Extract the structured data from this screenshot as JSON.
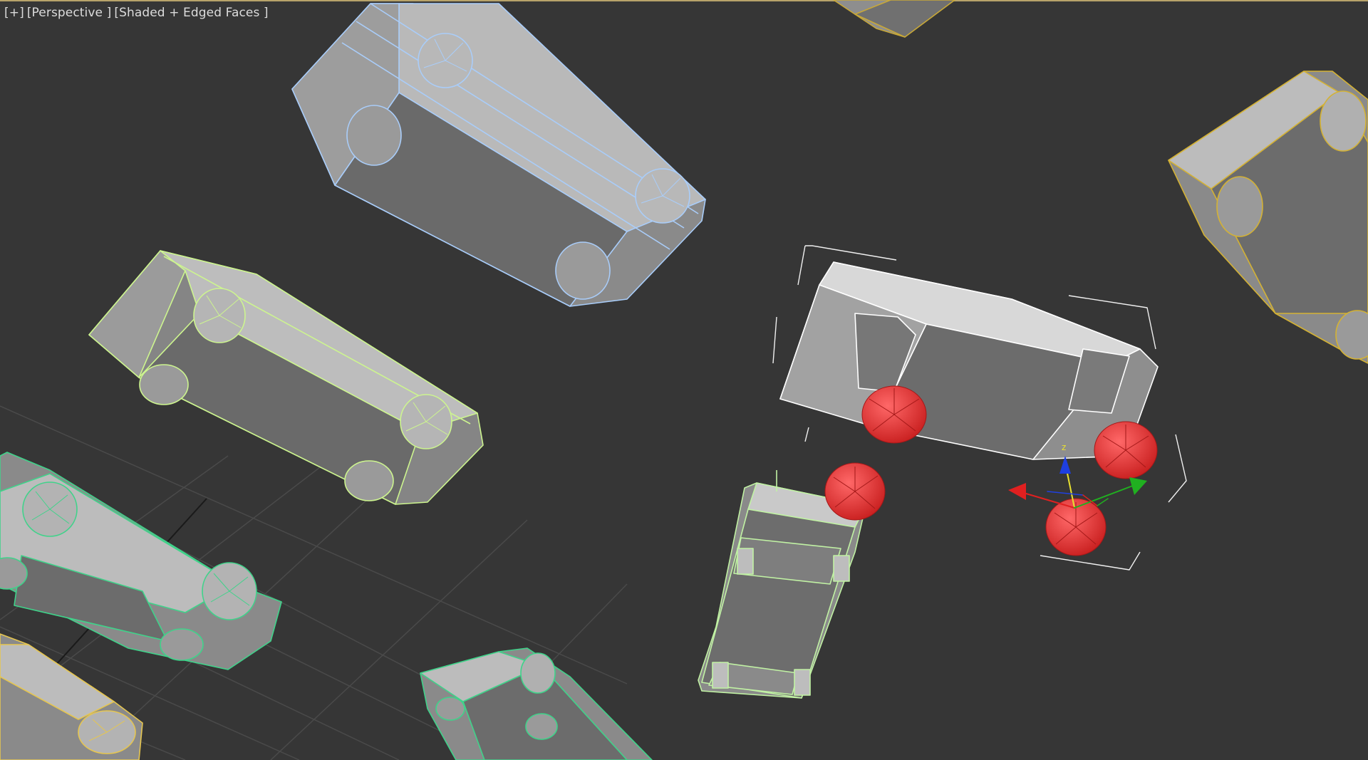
{
  "viewport": {
    "labels": {
      "menu": "[+]",
      "view": "[Perspective ]",
      "shading": "[Shaded + Edged Faces ]"
    }
  },
  "scene": {
    "objects": [
      {
        "name": "car-blue-wire",
        "wire_color": "#9fc6ff",
        "selected": false
      },
      {
        "name": "car-lightgreen-wire",
        "wire_color": "#c8f08c",
        "selected": false
      },
      {
        "name": "car-white-selected",
        "wire_color": "#ffffff",
        "selected": true
      },
      {
        "name": "car-small-lightgreen",
        "wire_color": "#b8f09a",
        "selected": false
      },
      {
        "name": "car-green-wire-bottom-left",
        "wire_color": "#45d28a",
        "selected": false
      },
      {
        "name": "car-green-wire-bottom",
        "wire_color": "#45d28a",
        "selected": false
      },
      {
        "name": "car-yellow-wire-right",
        "wire_color": "#d8b638",
        "selected": false
      },
      {
        "name": "car-yellow-wire-bottom-left",
        "wire_color": "#e0c050",
        "selected": false
      },
      {
        "name": "car-yellow-wire-top",
        "wire_color": "#c8a838",
        "selected": false
      },
      {
        "name": "red-wheel-helpers",
        "wire_color": "#ff4040",
        "selected": false
      }
    ],
    "gizmo": {
      "x_color": "#e02020",
      "y_color": "#20b020",
      "z_color": "#2040e0",
      "z_label": "z"
    }
  }
}
